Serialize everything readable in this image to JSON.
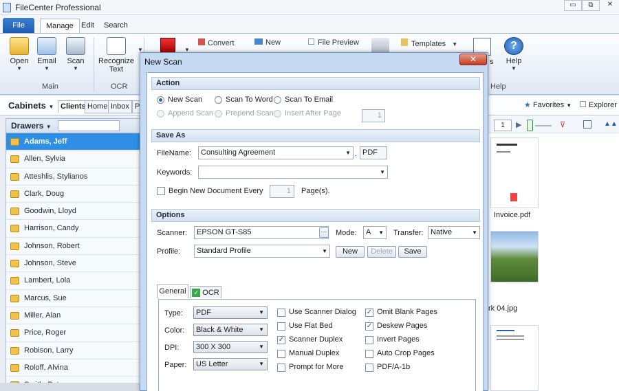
{
  "app": {
    "title": "FileCenter Professional",
    "window_buttons": [
      "▭",
      "⧉",
      "✕"
    ]
  },
  "ribbon": {
    "tabs": [
      "File",
      "Manage",
      "Edit",
      "Search"
    ],
    "buttons": {
      "open": "Open",
      "email": "Email",
      "scan": "Scan",
      "recognize_1": "Recognize",
      "recognize_2": "Text",
      "convert": "Convert",
      "new": "New",
      "file_preview": "File Preview",
      "templates": "Templates",
      "help": "Help"
    },
    "groups": {
      "main": "Main",
      "ocr": "OCR",
      "help": "Help"
    }
  },
  "cabinets": {
    "label": "Cabinets",
    "tabs": [
      "Clients",
      "Home",
      "Inbox",
      "P"
    ],
    "drawers_label": "Drawers",
    "drawers": [
      "Adams, Jeff",
      "Allen, Sylvia",
      "Atteshlis, Stylianos",
      "Clark, Doug",
      "Goodwin, Lloyd",
      "Harrison, Candy",
      "Johnson, Robert",
      "Johnson, Steve",
      "Lambert, Lola",
      "Marcus, Sue",
      "Miller, Alan",
      "Price, Roger",
      "Robison, Larry",
      "Roloff, Alvina",
      "Smith, Pete"
    ],
    "selected_index": 0
  },
  "right": {
    "favorites": "Favorites",
    "explorer": "Explorer",
    "page_num": "1",
    "files": [
      "Invoice.pdf",
      "rk 04.jpg"
    ]
  },
  "dialog": {
    "title": "New Scan",
    "close": "✕",
    "action": {
      "header": "Action",
      "new_scan": "New Scan",
      "scan_to_word": "Scan To Word",
      "scan_to_email": "Scan To Email",
      "append_scan": "Append Scan",
      "prepend_scan": "Prepend Scan",
      "insert_after_page": "Insert After Page",
      "page_value": "1"
    },
    "save_as": {
      "header": "Save As",
      "filename_label": "FileName:",
      "filename_value": "Consulting Agreement",
      "dot": ".",
      "extension": "PDF",
      "keywords_label": "Keywords:",
      "keywords_value": "",
      "begin_new_doc": "Begin New Document Every",
      "pages_value": "1",
      "pages_label": "Page(s)."
    },
    "options": {
      "header": "Options",
      "scanner_label": "Scanner:",
      "scanner_value": "EPSON GT-S85",
      "browse": "···",
      "mode_label": "Mode:",
      "mode_value": "A",
      "transfer_label": "Transfer:",
      "transfer_value": "Native",
      "profile_label": "Profile:",
      "profile_value": "Standard Profile",
      "btn_new": "New",
      "btn_delete": "Delete",
      "btn_save": "Save",
      "tab_general": "General",
      "tab_ocr": "OCR",
      "type_label": "Type:",
      "type_value": "PDF",
      "color_label": "Color:",
      "color_value": "Black & White",
      "dpi_label": "DPI:",
      "dpi_value": "300 X 300",
      "paper_label": "Paper:",
      "paper_value": "US Letter",
      "checks_col1": [
        {
          "label": "Use Scanner Dialog",
          "checked": false
        },
        {
          "label": "Use Flat Bed",
          "checked": false
        },
        {
          "label": "Scanner Duplex",
          "checked": true
        },
        {
          "label": "Manual Duplex",
          "checked": false
        },
        {
          "label": "Prompt for More",
          "checked": false
        }
      ],
      "checks_col2": [
        {
          "label": "Omit Blank Pages",
          "checked": true
        },
        {
          "label": "Deskew Pages",
          "checked": true
        },
        {
          "label": "Invert Pages",
          "checked": false
        },
        {
          "label": "Auto Crop Pages",
          "checked": false
        },
        {
          "label": "PDF/A-1b",
          "checked": false
        }
      ]
    }
  }
}
